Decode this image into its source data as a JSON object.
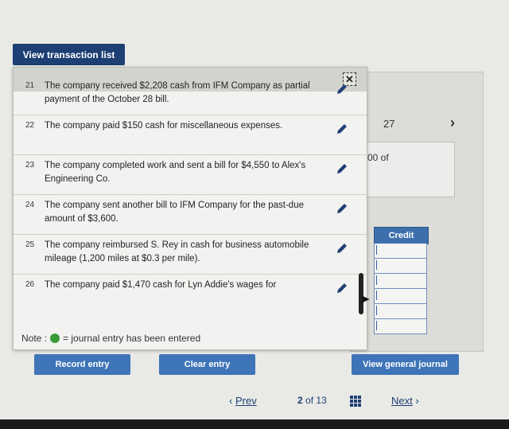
{
  "header": {
    "view_list_label": "View transaction list"
  },
  "background": {
    "date_fragment": "27",
    "box_text": "00 of",
    "credit_header": "Credit",
    "credit_rows": 6
  },
  "popup": {
    "close_symbol": "✕",
    "items": [
      {
        "num": "21",
        "text": "The company received $2,208 cash from IFM Company as partial payment of the October 28 bill."
      },
      {
        "num": "22",
        "text": "The company paid $150 cash for miscellaneous expenses."
      },
      {
        "num": "23",
        "text": "The company completed work and sent a bill for $4,550 to Alex's Engineering Co."
      },
      {
        "num": "24",
        "text": "The company sent another bill to IFM Company for the past-due amount of $3,600."
      },
      {
        "num": "25",
        "text": "The company reimbursed S. Rey in cash for business automobile mileage (1,200 miles at $0.3 per mile)."
      },
      {
        "num": "26",
        "text": "The company paid $1,470 cash for Lyn Addie's wages for"
      }
    ],
    "note_prefix": "Note :",
    "note_suffix": "= journal entry has been entered"
  },
  "actions": {
    "record_entry": "Record entry",
    "clear_entry": "Clear entry",
    "view_general_journal": "View general journal"
  },
  "pager": {
    "prev": "Prev",
    "current": "2",
    "of_label": "of",
    "total": "13",
    "next": "Next"
  },
  "colors": {
    "accent_dark": "#1d3f73",
    "accent": "#3e74b8",
    "entered_dot": "#3a9a3a"
  }
}
